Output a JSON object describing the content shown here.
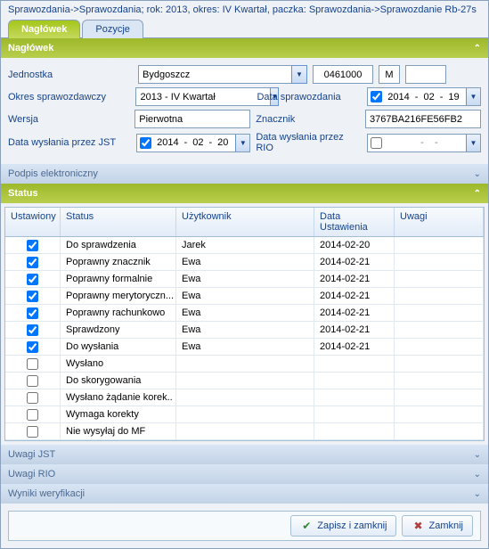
{
  "breadcrumb": "Sprawozdania->Sprawozdania; rok: 2013, okres: IV Kwartał, paczka: Sprawozdania->Sprawozdanie Rb-27s",
  "tabs": {
    "header": "Nagłówek",
    "positions": "Pozycje"
  },
  "sections": {
    "header": "Nagłówek",
    "signature": "Podpis elektroniczny",
    "status": "Status",
    "uwagi_jst": "Uwagi JST",
    "uwagi_rio": "Uwagi RIO",
    "wyniki": "Wyniki weryfikacji"
  },
  "form": {
    "lbl_unit": "Jednostka",
    "unit": "Bydgoszcz",
    "code": "0461000",
    "code2": "M",
    "lbl_period": "Okres sprawozdawczy",
    "period": "2013 - IV Kwartał",
    "lbl_date": "Data sprawozdania",
    "date_y": "2014",
    "date_m": "02",
    "date_d": "19",
    "lbl_version": "Wersja",
    "version": "Pierwotna",
    "lbl_marker": "Znacznik",
    "marker": "3767BA216FE56FB2",
    "lbl_sent_jst": "Data wysłania przez JST",
    "sent_y": "2014",
    "sent_m": "02",
    "sent_d": "20",
    "lbl_sent_rio": "Data wysłania przez RIO",
    "rio_sep": "-"
  },
  "grid": {
    "h_set": "Ustawiony",
    "h_status": "Status",
    "h_user": "Użytkownik",
    "h_date": "Data Ustawienia",
    "h_notes": "Uwagi",
    "rows": [
      {
        "set": true,
        "status": "Do sprawdzenia",
        "user": "Jarek",
        "date": "2014-02-20",
        "notes": ""
      },
      {
        "set": true,
        "status": "Poprawny znacznik",
        "user": "Ewa",
        "date": "2014-02-21",
        "notes": ""
      },
      {
        "set": true,
        "status": "Poprawny formalnie",
        "user": "Ewa",
        "date": "2014-02-21",
        "notes": ""
      },
      {
        "set": true,
        "status": "Poprawny merytoryczn...",
        "user": "Ewa",
        "date": "2014-02-21",
        "notes": ""
      },
      {
        "set": true,
        "status": "Poprawny rachunkowo",
        "user": "Ewa",
        "date": "2014-02-21",
        "notes": ""
      },
      {
        "set": true,
        "status": "Sprawdzony",
        "user": "Ewa",
        "date": "2014-02-21",
        "notes": ""
      },
      {
        "set": true,
        "status": "Do wysłania",
        "user": "Ewa",
        "date": "2014-02-21",
        "notes": ""
      },
      {
        "set": false,
        "status": "Wysłano",
        "user": "",
        "date": "",
        "notes": ""
      },
      {
        "set": false,
        "status": "Do skorygowania",
        "user": "",
        "date": "",
        "notes": ""
      },
      {
        "set": false,
        "status": "Wysłano żądanie korek..",
        "user": "",
        "date": "",
        "notes": ""
      },
      {
        "set": false,
        "status": "Wymaga korekty",
        "user": "",
        "date": "",
        "notes": ""
      },
      {
        "set": false,
        "status": "Nie wysyłaj do MF",
        "user": "",
        "date": "",
        "notes": ""
      }
    ]
  },
  "buttons": {
    "save_close": "Zapisz i zamknij",
    "close": "Zamknij"
  }
}
